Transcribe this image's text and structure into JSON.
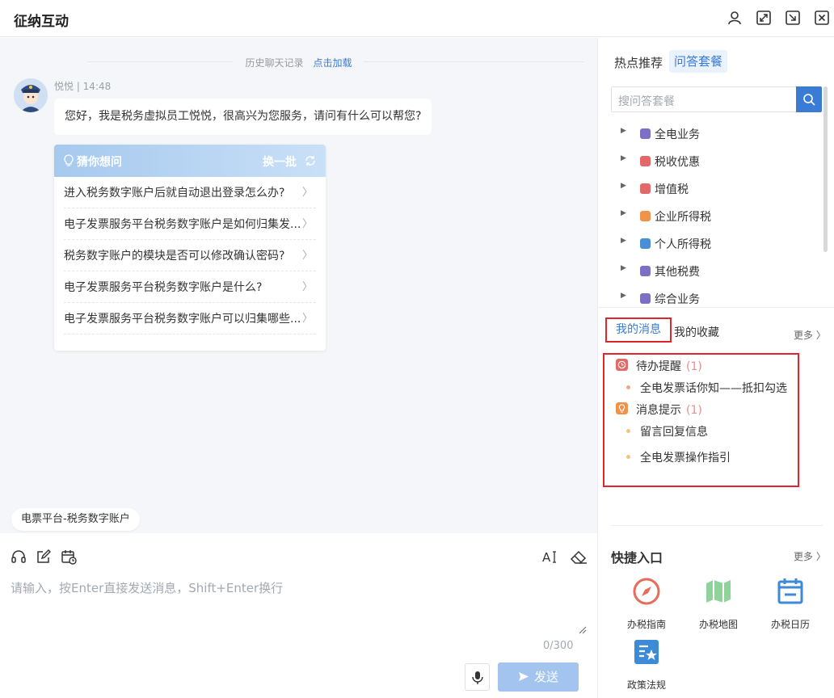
{
  "window": {
    "title": "征纳互动"
  },
  "chat": {
    "history_label": "历史聊天记录",
    "history_link": "点击加载",
    "sender": "悦悦 | 14:48",
    "greeting": "您好，我是税务虚拟员工悦悦，很高兴为您服务，请问有什么可以帮您?",
    "guess_title": "猜你想问",
    "guess_refresh": "换一批",
    "guess_items": [
      "进入税务数字账户后就自动退出登录怎么办?",
      "电子发票服务平台税务数字账户是如何归集发...",
      "税务数字账户的模块是否可以修改确认密码?",
      "电子发票服务平台税务数字账户是什么?",
      "电子发票服务平台税务数字账户可以归集哪些..."
    ],
    "context_tag": "电票平台-税务数字账户"
  },
  "input": {
    "placeholder": "请输入，按Enter直接发送消息，Shift+Enter换行",
    "counter": "0/300",
    "send_label": "发送"
  },
  "right": {
    "tabs": [
      "热点推荐",
      "问答套餐"
    ],
    "active_tab": "问答套餐",
    "search_placeholder": "搜问答套餐",
    "tree": [
      {
        "label": "全电业务",
        "color": "#7b6fc6"
      },
      {
        "label": "税收优惠",
        "color": "#e36868"
      },
      {
        "label": "增值税",
        "color": "#e36868"
      },
      {
        "label": "企业所得税",
        "color": "#f0934a"
      },
      {
        "label": "个人所得税",
        "color": "#4a8fd6"
      },
      {
        "label": "其他税费",
        "color": "#7b6fc6"
      },
      {
        "label": "综合业务",
        "color": "#7b6fc6"
      }
    ],
    "msg_tabs": [
      "我的消息",
      "我的收藏"
    ],
    "more": "更多",
    "groups": [
      {
        "label": "待办提醒",
        "count": "(1)",
        "color": "#e36868",
        "items": [
          "全电发票话你知——抵扣勾选"
        ],
        "dot": "#f0a58a"
      },
      {
        "label": "消息提示",
        "count": "(1)",
        "color": "#f0934a",
        "items": [
          "留言回复信息",
          "全电发票操作指引"
        ],
        "dot": "#f3c27a"
      }
    ],
    "quick_title": "快捷入口",
    "quick": [
      {
        "label": "办税指南",
        "icon": "compass-icon"
      },
      {
        "label": "办税地图",
        "icon": "map-icon"
      },
      {
        "label": "办税日历",
        "icon": "calendar-icon"
      },
      {
        "label": "政策法规",
        "icon": "policy-icon"
      }
    ]
  }
}
